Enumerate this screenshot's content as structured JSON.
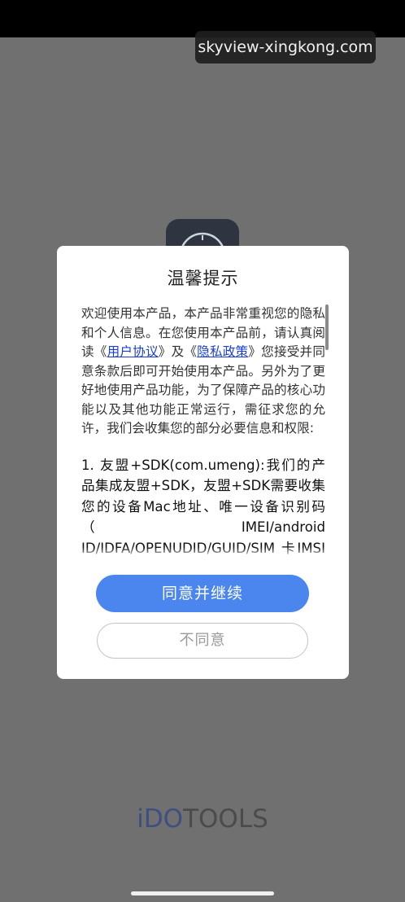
{
  "watermark": "skyview-xingkong.com",
  "dialog": {
    "title": "温馨提示",
    "intro_before_agreement": "欢迎使用本产品，本产品非常重视您的隐私和个人信息。在您使用本产品前，请认真阅读《",
    "user_agreement_link": "用户协议",
    "intro_between_links": "》及《",
    "privacy_policy_link": "隐私政策",
    "intro_after_links": "》您接受并同意条款后即可开始使用本产品。另外为了更好地使用产品功能，为了保障产品的核心功能以及其他功能正常运行，需征求您的允许，我们会收集您的部分必要信息和权限:",
    "item_1": "1. 友盟+SDK(com.umeng):我们的产品集成友盟+SDK，友盟+SDK需要收集您的设备Mac地址、唯一设备识别码（IMEI/android ID/IDFA/OPENUDID/GUID/SIM 卡IMSI信",
    "agree_button": "同意并继续",
    "disagree_button": "不同意"
  },
  "logo": {
    "part1": "iDO",
    "part2": "TOOLS"
  },
  "colors": {
    "link": "#1a3fd6",
    "agree_button": "#4a86ee",
    "backdrop": "#6f706f"
  },
  "icons": {
    "app_icon": "compass-clock-icon"
  }
}
